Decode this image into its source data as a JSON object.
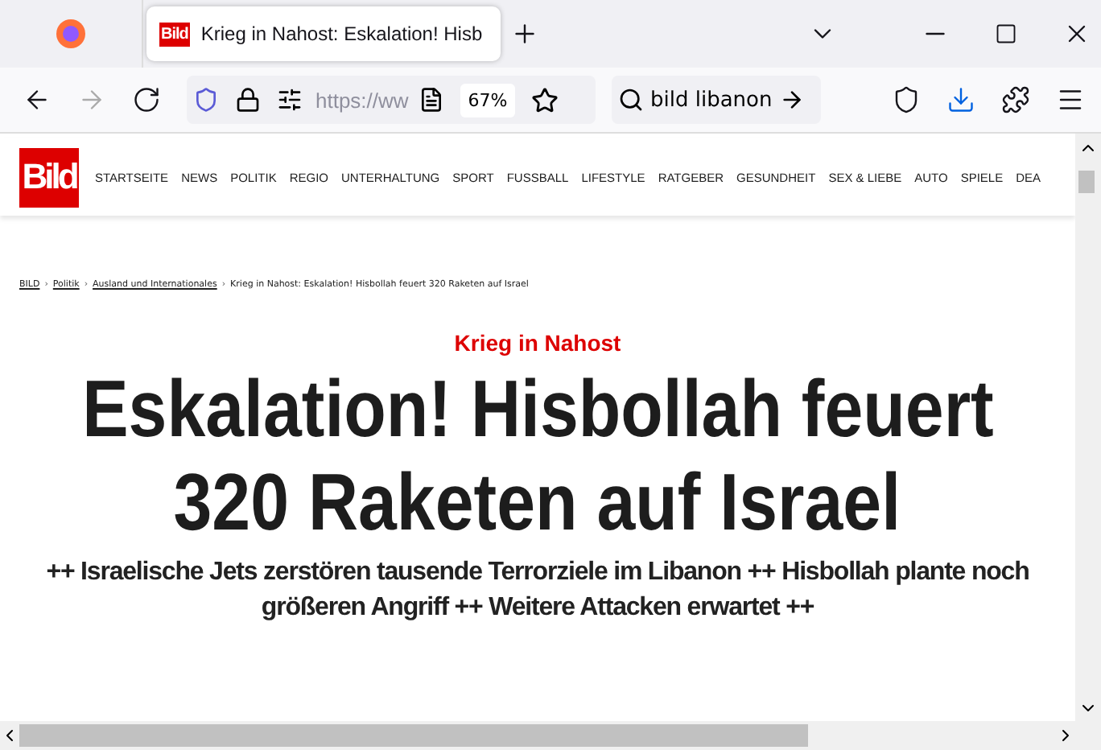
{
  "tab": {
    "logo": "Bild",
    "title": "Krieg in Nahost: Eskalation! Hisb",
    "selected": true
  },
  "toolbar": {
    "url": "https://ww",
    "zoom": "67%",
    "search": "bild libanon"
  },
  "site": {
    "logo": "Bild",
    "nav": [
      "STARTSEITE",
      "NEWS",
      "POLITIK",
      "REGIO",
      "UNTERHALTUNG",
      "SPORT",
      "FUSSBALL",
      "LIFESTYLE",
      "RATGEBER",
      "GESUNDHEIT",
      "SEX & LIEBE",
      "AUTO",
      "SPIELE",
      "DEA"
    ]
  },
  "breadcrumb": [
    {
      "label": "BILD",
      "link": true
    },
    {
      "separator": "›",
      "label": "Politik",
      "link": true
    },
    {
      "separator": "›",
      "label": "Ausland und Internationales",
      "link": true
    },
    {
      "separator": "›",
      "label": "Krieg in Nahost: Eskalation! Hisbollah feuert 320 Raketen auf Israel",
      "link": false
    }
  ],
  "article": {
    "kicker": "Krieg in Nahost",
    "headline": [
      "Eskalation! Hisbollah feuert",
      "320 Raketen auf Israel"
    ],
    "teaser": "++ Israelische Jets zerstören tausende Terrorziele im Libanon ++ Hisbollah plante noch größeren Angriff ++ Weitere Attacken erwartet ++"
  }
}
